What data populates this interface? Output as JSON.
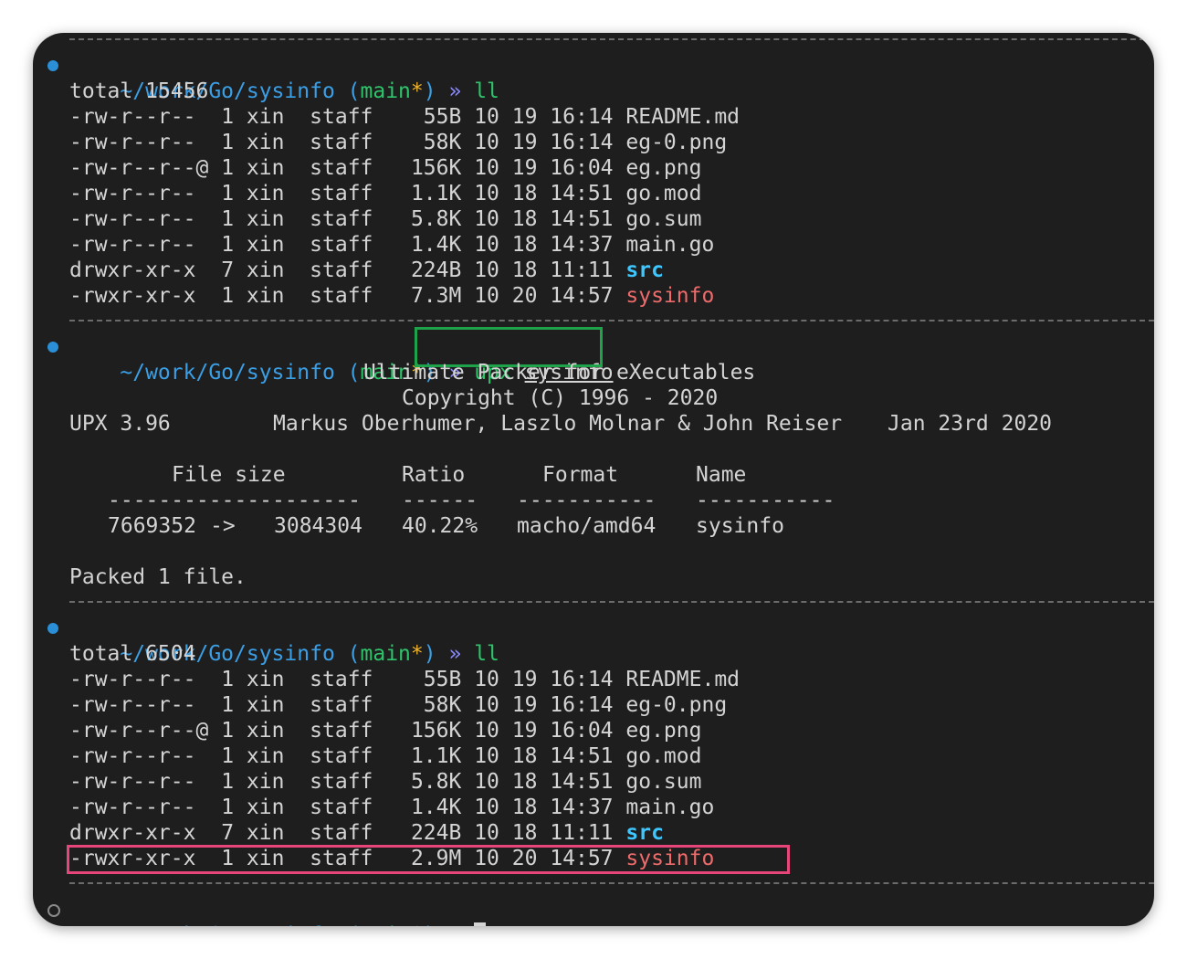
{
  "prompt": {
    "path": "~/work/Go/sysinfo",
    "branch_open": "(",
    "branch": "main",
    "dirty": "*",
    "branch_close": ")",
    "arrow": "»"
  },
  "block1": {
    "command": "ll",
    "total": "total 15456",
    "entries": [
      {
        "perm": "-rw-r--r-- ",
        "links": "1",
        "user": "xin",
        "group": "staff",
        "size": " 55B",
        "date": "10 19 16:14",
        "name": "README.md",
        "type": "file"
      },
      {
        "perm": "-rw-r--r-- ",
        "links": "1",
        "user": "xin",
        "group": "staff",
        "size": " 58K",
        "date": "10 19 16:14",
        "name": "eg-0.png",
        "type": "file"
      },
      {
        "perm": "-rw-r--r--@",
        "links": "1",
        "user": "xin",
        "group": "staff",
        "size": "156K",
        "date": "10 19 16:04",
        "name": "eg.png",
        "type": "file"
      },
      {
        "perm": "-rw-r--r-- ",
        "links": "1",
        "user": "xin",
        "group": "staff",
        "size": "1.1K",
        "date": "10 18 14:51",
        "name": "go.mod",
        "type": "file"
      },
      {
        "perm": "-rw-r--r-- ",
        "links": "1",
        "user": "xin",
        "group": "staff",
        "size": "5.8K",
        "date": "10 18 14:51",
        "name": "go.sum",
        "type": "file"
      },
      {
        "perm": "-rw-r--r-- ",
        "links": "1",
        "user": "xin",
        "group": "staff",
        "size": "1.4K",
        "date": "10 18 14:37",
        "name": "main.go",
        "type": "file"
      },
      {
        "perm": "drwxr-xr-x ",
        "links": "7",
        "user": "xin",
        "group": "staff",
        "size": "224B",
        "date": "10 18 11:11",
        "name": "src",
        "type": "dir"
      },
      {
        "perm": "-rwxr-xr-x ",
        "links": "1",
        "user": "xin",
        "group": "staff",
        "size": "7.3M",
        "date": "10 20 14:57",
        "name": "sysinfo",
        "type": "exe"
      }
    ]
  },
  "block2": {
    "command_word": "upx",
    "command_arg": "sysinfo",
    "banner_line1": "Ultimate Packer for eXecutables",
    "banner_line2": "Copyright (C) 1996 - 2020",
    "version": "UPX 3.96",
    "authors": "Markus Oberhumer, Laszlo Molnar & John Reiser",
    "release_date": "Jan 23rd 2020",
    "table": {
      "headers": [
        "File size",
        "Ratio",
        "Format",
        "Name"
      ],
      "rule_file_size": "--------------------",
      "rule_ratio": "------",
      "rule_format": "-----------",
      "rule_name": "-----------",
      "row": {
        "from": "7669352",
        "sep": "->",
        "to": "3084304",
        "ratio": "40.22%",
        "format": "macho/amd64",
        "name": "sysinfo"
      }
    },
    "summary": "Packed 1 file."
  },
  "block3": {
    "command": "ll",
    "total": "total 6504",
    "entries": [
      {
        "perm": "-rw-r--r-- ",
        "links": "1",
        "user": "xin",
        "group": "staff",
        "size": " 55B",
        "date": "10 19 16:14",
        "name": "README.md",
        "type": "file"
      },
      {
        "perm": "-rw-r--r-- ",
        "links": "1",
        "user": "xin",
        "group": "staff",
        "size": " 58K",
        "date": "10 19 16:14",
        "name": "eg-0.png",
        "type": "file"
      },
      {
        "perm": "-rw-r--r--@",
        "links": "1",
        "user": "xin",
        "group": "staff",
        "size": "156K",
        "date": "10 19 16:04",
        "name": "eg.png",
        "type": "file"
      },
      {
        "perm": "-rw-r--r-- ",
        "links": "1",
        "user": "xin",
        "group": "staff",
        "size": "1.1K",
        "date": "10 18 14:51",
        "name": "go.mod",
        "type": "file"
      },
      {
        "perm": "-rw-r--r-- ",
        "links": "1",
        "user": "xin",
        "group": "staff",
        "size": "5.8K",
        "date": "10 18 14:51",
        "name": "go.sum",
        "type": "file"
      },
      {
        "perm": "-rw-r--r-- ",
        "links": "1",
        "user": "xin",
        "group": "staff",
        "size": "1.4K",
        "date": "10 18 14:37",
        "name": "main.go",
        "type": "file"
      },
      {
        "perm": "drwxr-xr-x ",
        "links": "7",
        "user": "xin",
        "group": "staff",
        "size": "224B",
        "date": "10 18 11:11",
        "name": "src",
        "type": "dir"
      },
      {
        "perm": "-rwxr-xr-x ",
        "links": "1",
        "user": "xin",
        "group": "staff",
        "size": "2.9M",
        "date": "10 20 14:57",
        "name": "sysinfo",
        "type": "exe"
      }
    ]
  },
  "highlights": {
    "command_box_color": "#1fa34a",
    "result_box_color": "#e8457a"
  },
  "colors": {
    "background": "#1e1e1e",
    "text": "#d4d4d4",
    "path": "#3b9fe5",
    "branch": "#2ec46a",
    "dirty": "#f0b429",
    "directory": "#3ec6ff",
    "executable": "#ef6b6b"
  }
}
